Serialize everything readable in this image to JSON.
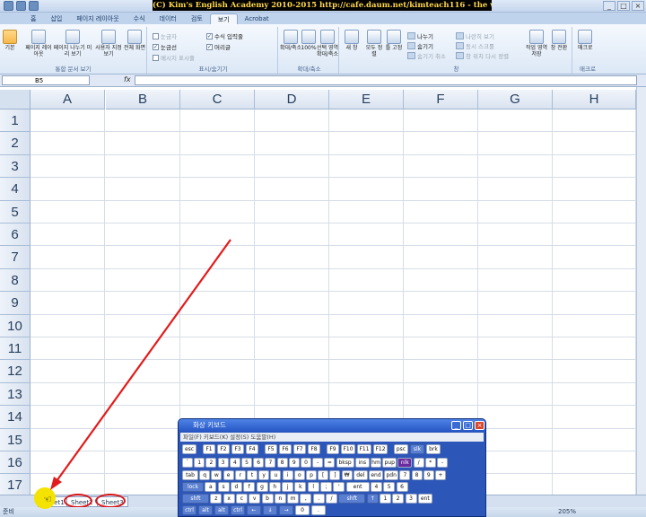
{
  "window": {
    "banner": "(C) Kim's English Academy 2010-2015 http://cafe.daum.net/kimteach116 - the whole videos provide"
  },
  "ribbon": {
    "tabs": [
      "홈",
      "삽입",
      "페이지 레이아웃",
      "수식",
      "데이터",
      "검토",
      "보기",
      "Acrobat"
    ],
    "active_tab": "보기",
    "groups": {
      "workbook_views": {
        "label": "통합 문서 보기",
        "buttons": [
          "기본",
          "페이지 레이아웃",
          "페이지 나누기 미리 보기",
          "사용자 지정 보기",
          "전체 화면"
        ]
      },
      "show_hide": {
        "label": "표시/숨기기",
        "options": [
          "눈금자",
          "눈금선",
          "메시지 표시줄",
          "수식 입력줄",
          "머리글"
        ]
      },
      "zoom": {
        "label": "확대/축소",
        "buttons": [
          "확대/축소",
          "100%",
          "선택 영역 확대/축소"
        ]
      },
      "window": {
        "label": "창",
        "buttons": [
          "새 창",
          "모두 정렬",
          "틀 고정",
          "나누기",
          "숨기기",
          "숨기기 취소",
          "나란히 보기",
          "동시 스크롤",
          "창 위치 다시 정렬",
          "작업 영역 저장",
          "창 전환"
        ]
      },
      "macro": {
        "label": "매크로",
        "buttons": [
          "매크로"
        ]
      }
    }
  },
  "formula_bar": {
    "name_box": "B5",
    "fx": "fx",
    "value": ""
  },
  "grid": {
    "columns": [
      "A",
      "B",
      "C",
      "D",
      "E",
      "F",
      "G",
      "H"
    ],
    "rows": [
      "1",
      "2",
      "3",
      "4",
      "5",
      "6",
      "7",
      "8",
      "9",
      "10",
      "11",
      "12",
      "13",
      "14",
      "15",
      "16",
      "17"
    ]
  },
  "sheets": {
    "tabs": [
      "Sheet1",
      "Sheet2",
      "Sheet3"
    ]
  },
  "status": {
    "ready": "준비",
    "zoom": "205%"
  },
  "keyboard": {
    "title": "화상 키보드",
    "menu": "파일(F)  키보드(K)  설정(S)  도움말(H)",
    "row1": [
      "esc",
      "F1",
      "F2",
      "F3",
      "F4",
      "F5",
      "F6",
      "F7",
      "F8",
      "F9",
      "F10",
      "F11",
      "F12",
      "psc",
      "slk",
      "brk"
    ],
    "row2": [
      "`",
      "1",
      "2",
      "3",
      "4",
      "5",
      "6",
      "7",
      "8",
      "9",
      "0",
      "-",
      "=",
      "bksp",
      "ins",
      "hm",
      "pup",
      "nlk",
      "/",
      "*",
      "-"
    ],
    "row3": [
      "tab",
      "q",
      "w",
      "e",
      "r",
      "t",
      "y",
      "u",
      "i",
      "o",
      "p",
      "[",
      "]",
      "₩",
      "del",
      "end",
      "pdn",
      "7",
      "8",
      "9",
      "+"
    ],
    "row4": [
      "lock",
      "a",
      "s",
      "d",
      "f",
      "g",
      "h",
      "j",
      "k",
      "l",
      ";",
      "'",
      "ent",
      "4",
      "5",
      "6"
    ],
    "row5": [
      "shft",
      "z",
      "x",
      "c",
      "v",
      "b",
      "n",
      "m",
      ",",
      ".",
      "/",
      "shft",
      "↑",
      "1",
      "2",
      "3",
      "ent"
    ],
    "row6": [
      "ctrl",
      "alt",
      "alt",
      "ctrl",
      "←",
      "↓",
      "→",
      "0",
      "."
    ]
  }
}
